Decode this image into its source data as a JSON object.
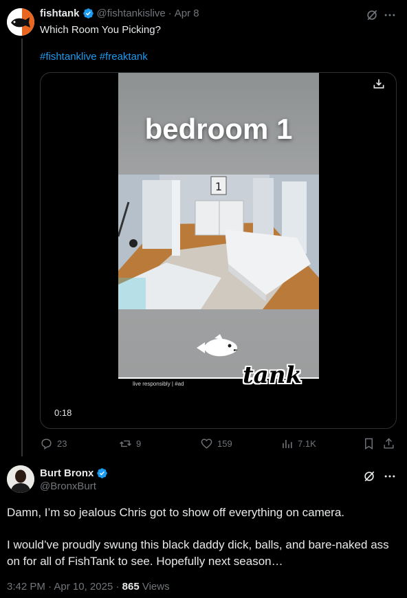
{
  "tweet": {
    "author_name": "fishtank",
    "handle": "@fishtankislive",
    "separator": "·",
    "date": "Apr 8",
    "text": "Which Room You Picking?",
    "hashtags": [
      "#fishtanklive",
      "#freaktank"
    ],
    "video": {
      "overlay_title": "bedroom 1",
      "duration": "0:18",
      "room_sign": "1",
      "footer_text": "live responsibly | #ad",
      "brand_logo_text": "tank"
    },
    "actions": {
      "replies": "23",
      "reposts": "9",
      "likes": "159",
      "views": "7.1K"
    }
  },
  "reply": {
    "author_name": "Burt Bronx",
    "handle": "@BronxBurt",
    "paragraph1": "Damn, I’m so jealous Chris got to show off everything on camera.",
    "paragraph2": "I would’ve proudly swung this black daddy dick,  balls, and bare-naked ass on for all of FishTank to see. Hopefully next season…",
    "time": "3:42 PM",
    "date": "Apr 10, 2025",
    "views_count": "865",
    "views_label": "Views"
  },
  "colors": {
    "background": "#000000",
    "text": "#e7e9ea",
    "muted": "#71767b",
    "link": "#1d9bf0",
    "verified": "#1d9bf0",
    "divider": "#2f3336"
  },
  "icons": [
    "grok-icon",
    "more-icon",
    "download-icon",
    "reply-icon",
    "repost-icon",
    "like-icon",
    "views-icon",
    "bookmark-icon",
    "share-icon",
    "verified-badge-icon"
  ]
}
